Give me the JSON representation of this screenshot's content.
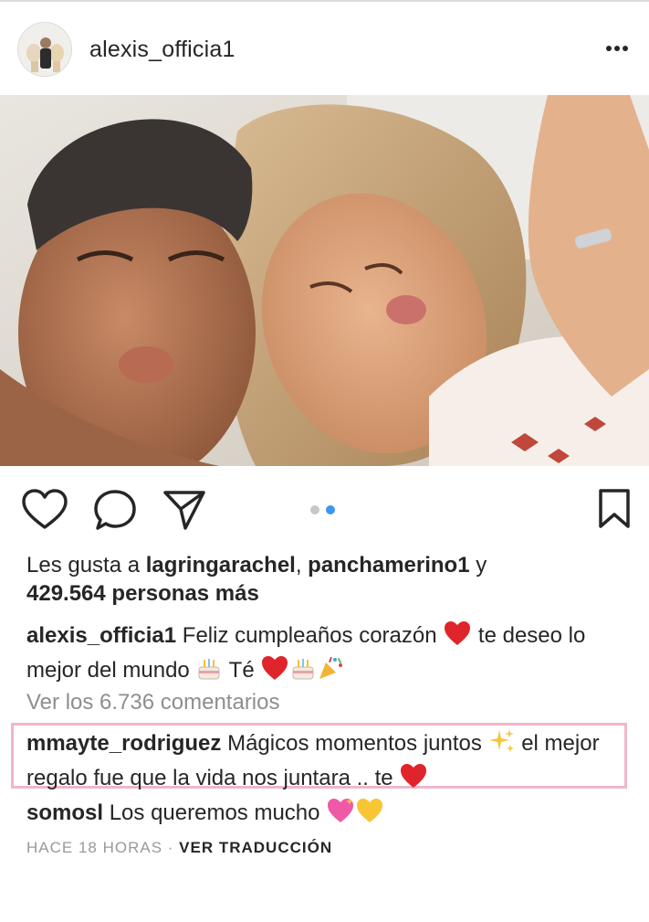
{
  "post": {
    "username": "alexis_officia1",
    "likes": {
      "prefix": "Les gusta a ",
      "user1": "lagringarachel",
      "comma": ", ",
      "user2": "panchamerino1",
      "and": " y",
      "count": "429.564 personas más"
    },
    "caption": {
      "user": "alexis_officia1",
      "text1": " Feliz cumpleaños corazón ",
      "text2": " te deseo lo mejor del mundo ",
      "text3": "  Té "
    },
    "view_comments": "Ver los 6.736 comentarios",
    "comments": [
      {
        "user": "mmayte_rodriguez",
        "text1": " Mágicos momentos juntos ",
        "text2": " el mejor regalo fue que la vida nos juntara .. te "
      },
      {
        "user": "somosl",
        "text1": " Los queremos mucho "
      }
    ],
    "time": "HACE 18 HORAS",
    "separator": " · ",
    "translate": "VER TRADUCCIÓN"
  },
  "icons": {
    "more": "more-options-icon",
    "like": "heart-icon",
    "comment": "comment-icon",
    "share": "paper-plane-icon",
    "save": "bookmark-icon",
    "emoji": [
      "red-heart-emoji",
      "birthday-cake-emoji",
      "party-popper-emoji",
      "sparkles-emoji",
      "sparkling-heart-emoji",
      "yellow-heart-emoji"
    ]
  },
  "carousel": {
    "total": 2,
    "active": 2
  },
  "colors": {
    "text": "#262626",
    "muted": "#8e8e8e",
    "dot_active": "#3897f0",
    "dot_inactive": "#c7c7c7",
    "highlight_border": "#f0b6cc"
  }
}
